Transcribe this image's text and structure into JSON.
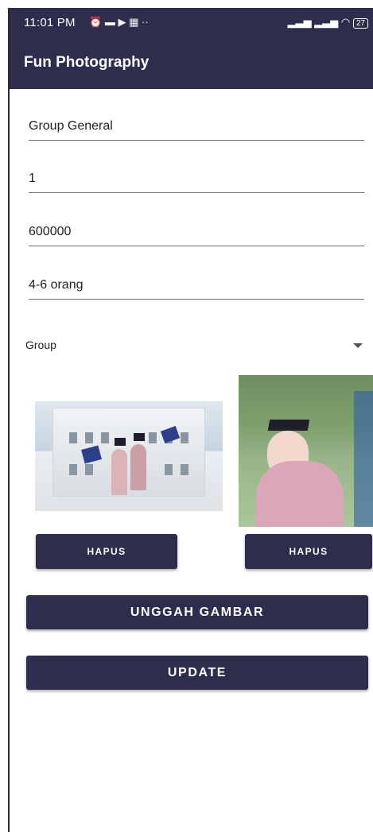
{
  "status_bar": {
    "time": "11:01 PM",
    "left_icons": [
      "alarm-icon",
      "message-icon",
      "video-icon",
      "grid-icon",
      "more-dots-icon"
    ],
    "right_icons": [
      "signal-icon",
      "4g-signal-icon",
      "wifi-icon",
      "battery-icon"
    ],
    "battery": "27"
  },
  "app_bar": {
    "title": "Fun Photography"
  },
  "form": {
    "name_value": "Group General",
    "qty_value": "1",
    "price_value": "600000",
    "capacity_value": "4-6 orang",
    "category_value": "Group"
  },
  "images": [
    {
      "delete_label": "HAPUS"
    },
    {
      "delete_label": "HAPUS"
    }
  ],
  "actions": {
    "upload_label": "UNGGAH GAMBAR",
    "update_label": "UPDATE"
  },
  "colors": {
    "primary": "#2e2d4d",
    "divider": "#6b6b6b"
  }
}
